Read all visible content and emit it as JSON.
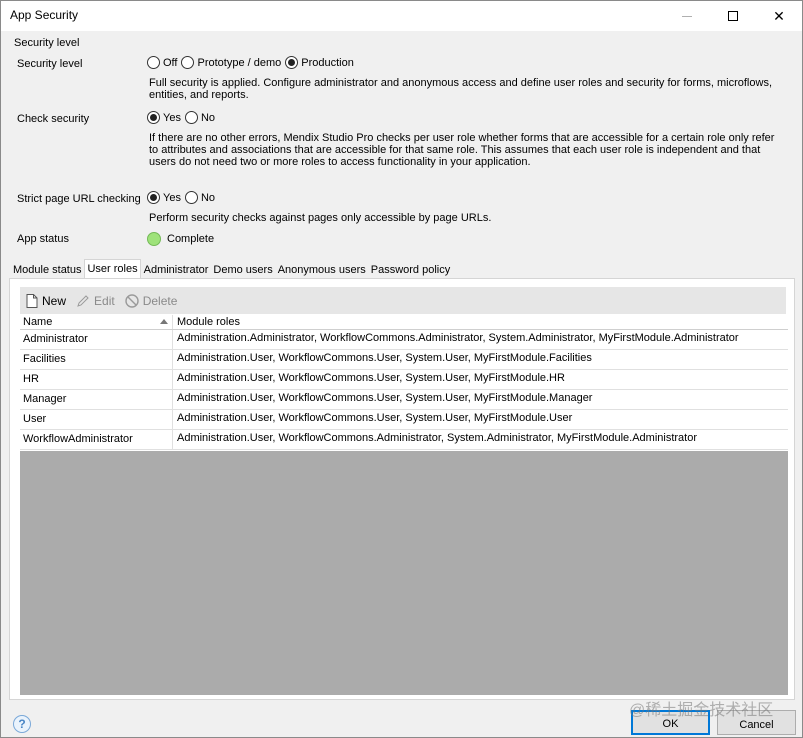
{
  "window": {
    "title": "App Security"
  },
  "security": {
    "group_title": "Security level",
    "level": {
      "label": "Security level",
      "options": [
        "Off",
        "Prototype / demo",
        "Production"
      ],
      "selected": "Production",
      "description": "Full security is applied. Configure administrator and anonymous access and define user roles and security for forms, microflows, entities, and reports."
    },
    "check": {
      "label": "Check security",
      "options": [
        "Yes",
        "No"
      ],
      "selected": "Yes",
      "description": "If there are no other errors, Mendix Studio Pro checks per user role whether forms that are accessible for a certain role only refer to attributes and associations that are accessible for that same role. This assumes that each user role is independent and that users do not need two or more roles to access functionality in your application."
    },
    "strict": {
      "label": "Strict page URL checking",
      "options": [
        "Yes",
        "No"
      ],
      "selected": "Yes",
      "description": "Perform security checks against pages only accessible by page URLs."
    },
    "status": {
      "label": "App status",
      "value": "Complete",
      "color": "#9ee27a"
    }
  },
  "tabs": [
    {
      "label": "Module status",
      "active": false
    },
    {
      "label": "User roles",
      "active": true
    },
    {
      "label": "Administrator",
      "active": false
    },
    {
      "label": "Demo users",
      "active": false
    },
    {
      "label": "Anonymous users",
      "active": false
    },
    {
      "label": "Password policy",
      "active": false
    }
  ],
  "toolbar": {
    "new_label": "New",
    "edit_label": "Edit",
    "delete_label": "Delete"
  },
  "grid": {
    "columns": [
      "Name",
      "Module roles"
    ],
    "rows": [
      {
        "name": "Administrator",
        "roles": "Administration.Administrator, WorkflowCommons.Administrator, System.Administrator, MyFirstModule.Administrator"
      },
      {
        "name": "Facilities",
        "roles": "Administration.User, WorkflowCommons.User, System.User, MyFirstModule.Facilities"
      },
      {
        "name": "HR",
        "roles": "Administration.User, WorkflowCommons.User, System.User, MyFirstModule.HR"
      },
      {
        "name": "Manager",
        "roles": "Administration.User, WorkflowCommons.User, System.User, MyFirstModule.Manager"
      },
      {
        "name": "User",
        "roles": "Administration.User, WorkflowCommons.User, System.User, MyFirstModule.User"
      },
      {
        "name": "WorkflowAdministrator",
        "roles": "Administration.User, WorkflowCommons.Administrator, System.Administrator, MyFirstModule.Administrator"
      }
    ]
  },
  "buttons": {
    "ok_label": "OK",
    "cancel_label": "Cancel",
    "help_icon": "?"
  },
  "watermark": "@稀土掘金技术社区"
}
